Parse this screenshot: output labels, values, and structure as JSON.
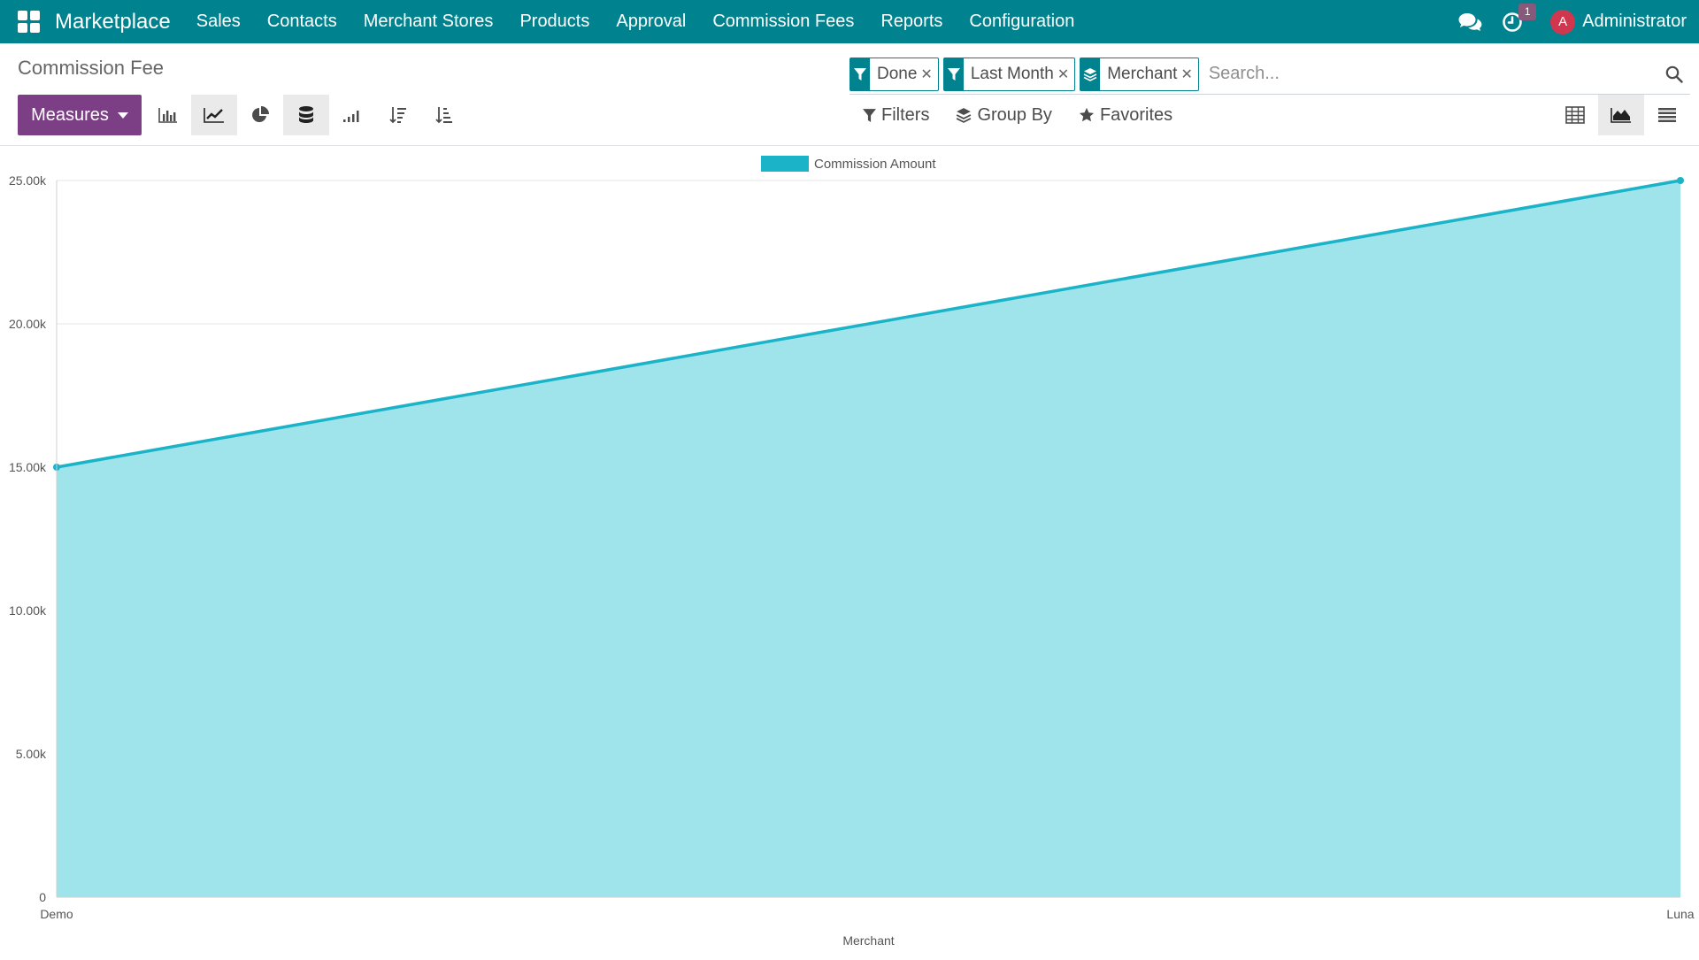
{
  "navbar": {
    "brand": "Marketplace",
    "menu": [
      "Sales",
      "Contacts",
      "Merchant Stores",
      "Products",
      "Approval",
      "Commission Fees",
      "Reports",
      "Configuration"
    ],
    "activity_badge": "1",
    "user_initial": "A",
    "user_name": "Administrator",
    "color": "#00838f"
  },
  "control_panel": {
    "title": "Commission Fee",
    "facets": [
      {
        "label": "Done",
        "icon": "filter-icon"
      },
      {
        "label": "Last Month",
        "icon": "filter-icon"
      },
      {
        "label": "Merchant",
        "icon": "layers-icon"
      }
    ],
    "search_placeholder": "Search...",
    "measures_label": "Measures",
    "measures_color": "#7c3f86",
    "filters_label": "Filters",
    "group_by_label": "Group By",
    "favorites_label": "Favorites"
  },
  "chart_data": {
    "type": "area",
    "categories": [
      "Demo",
      "Luna"
    ],
    "series": [
      {
        "name": "Commission Amount",
        "values": [
          15000,
          25000
        ],
        "color": "#1ab3c8",
        "fill": "#9ee4ea"
      }
    ],
    "xlabel": "Merchant",
    "ylabel": "",
    "ylim": [
      0,
      25000
    ],
    "yticks": [
      0,
      5000,
      10000,
      15000,
      20000,
      25000
    ],
    "ytick_labels": [
      "0",
      "5.00k",
      "10.00k",
      "15.00k",
      "20.00k",
      "25.00k"
    ],
    "grid": true,
    "legend": "top-center"
  }
}
